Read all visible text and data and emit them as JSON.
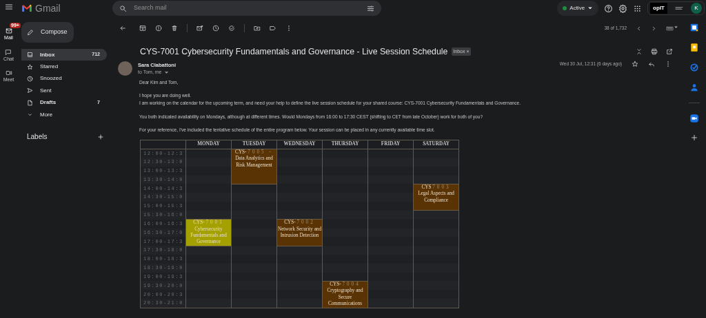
{
  "rail": [
    {
      "label": "Mail",
      "badge": "99+",
      "selected": true
    },
    {
      "label": "Chat",
      "selected": false
    },
    {
      "label": "Meet",
      "selected": false
    }
  ],
  "header": {
    "brand": "Gmail",
    "search_placeholder": "Search mail",
    "status": "Active",
    "org_logo": "opIT",
    "avatar_initial": "K"
  },
  "sidebar": {
    "compose": "Compose",
    "items": [
      {
        "label": "Inbox",
        "count": "712",
        "bold": true,
        "selected": true
      },
      {
        "label": "Starred",
        "bold": false,
        "selected": false
      },
      {
        "label": "Snoozed",
        "bold": false,
        "selected": false
      },
      {
        "label": "Sent",
        "bold": false,
        "selected": false
      },
      {
        "label": "Drafts",
        "count": "7",
        "bold": true,
        "selected": false
      },
      {
        "label": "More",
        "bold": false,
        "selected": false
      }
    ],
    "labels_heading": "Labels"
  },
  "toolbar": {
    "counter": "38 of 1,732"
  },
  "message": {
    "subject": "CYS-7001 Cybersecurity Fundamentals and Governance - Live Session Schedule",
    "tag": "Inbox",
    "tag_close": "×",
    "sender": "Sara Clabattoni",
    "recipients": "to Tom, me",
    "date": "Wed 30 Jul, 12:31 (6 days ago)",
    "paragraphs": [
      [
        "Dear Kim and Tom,"
      ],
      [
        "I hope you are doing well.",
        "I am working on the calendar for the upcoming term, and need your help to define the live session schedule for your shared course: CYS-7001 Cybersecurity Fundamentals and Governance."
      ],
      [
        "You both indicated availability on Mondays, although at different times. Would Mondays from 16:00 to 17:30 CEST (shifting to CET from late October) work for both of you?"
      ],
      [
        "For your reference, I've included the tentative schedule of the entire program below. Your session can be placed in any currently available time slot."
      ]
    ]
  },
  "schedule": {
    "times": [
      "12:00-12:3",
      "12:30-13:0",
      "13:00-13:3",
      "13:30-14:0",
      "14:00-14:3",
      "14:30-15:0",
      "15:00-15:3",
      "15:30-16:0",
      "16:00-16:3",
      "16:30-17:0",
      "17:00-17:3",
      "17:30-18:0",
      "18:00-18:3",
      "18:30-19:0",
      "19:00-19:3",
      "19:30-20:0",
      "20:00-20:3",
      "20:30-21:0"
    ],
    "days": [
      {
        "name": "MONDAY",
        "slots": [
          {
            "kind": "empty"
          },
          {
            "kind": "empty"
          },
          {
            "kind": "empty"
          },
          {
            "kind": "empty"
          },
          {
            "kind": "empty"
          },
          {
            "kind": "empty"
          },
          {
            "kind": "empty"
          },
          {
            "kind": "empty"
          },
          {
            "kind": "session",
            "code_prefix": "CYS-",
            "code_number": "7001",
            "title": "Cybersecurity Fundamentals and Governance",
            "color": "#a3a000"
          },
          {
            "kind": "continued"
          },
          {
            "kind": "continued"
          },
          {
            "kind": "empty"
          },
          {
            "kind": "empty"
          },
          {
            "kind": "empty"
          },
          {
            "kind": "empty"
          },
          {
            "kind": "empty"
          },
          {
            "kind": "empty"
          },
          {
            "kind": "empty"
          }
        ]
      },
      {
        "name": "TUESDAY",
        "slots": [
          {
            "kind": "session",
            "code_prefix": "CYS-",
            "code_number": "7005 -",
            "title": "Data Analytics and Risk Management",
            "color": "#5a3305"
          },
          {
            "kind": "continued"
          },
          {
            "kind": "continued"
          },
          {
            "kind": "continued"
          },
          {
            "kind": "empty"
          },
          {
            "kind": "empty"
          },
          {
            "kind": "empty"
          },
          {
            "kind": "empty"
          },
          {
            "kind": "empty"
          },
          {
            "kind": "empty"
          },
          {
            "kind": "empty"
          },
          {
            "kind": "empty"
          },
          {
            "kind": "empty"
          },
          {
            "kind": "empty"
          },
          {
            "kind": "empty"
          },
          {
            "kind": "empty"
          },
          {
            "kind": "empty"
          },
          {
            "kind": "empty"
          }
        ]
      },
      {
        "name": "WEDNESDAY",
        "slots": [
          {
            "kind": "empty"
          },
          {
            "kind": "empty"
          },
          {
            "kind": "empty"
          },
          {
            "kind": "empty"
          },
          {
            "kind": "empty"
          },
          {
            "kind": "empty"
          },
          {
            "kind": "empty"
          },
          {
            "kind": "empty"
          },
          {
            "kind": "session",
            "code_prefix": "CYS-",
            "code_number": "7002",
            "title": "Network Security and Intrusion Detection",
            "color": "#5a3305"
          },
          {
            "kind": "continued"
          },
          {
            "kind": "continued"
          },
          {
            "kind": "empty"
          },
          {
            "kind": "empty"
          },
          {
            "kind": "empty"
          },
          {
            "kind": "empty"
          },
          {
            "kind": "empty"
          },
          {
            "kind": "empty"
          },
          {
            "kind": "empty"
          }
        ]
      },
      {
        "name": "THURSDAY",
        "slots": [
          {
            "kind": "empty"
          },
          {
            "kind": "empty"
          },
          {
            "kind": "empty"
          },
          {
            "kind": "empty"
          },
          {
            "kind": "empty"
          },
          {
            "kind": "empty"
          },
          {
            "kind": "empty"
          },
          {
            "kind": "empty"
          },
          {
            "kind": "empty"
          },
          {
            "kind": "empty"
          },
          {
            "kind": "empty"
          },
          {
            "kind": "empty"
          },
          {
            "kind": "empty"
          },
          {
            "kind": "empty"
          },
          {
            "kind": "empty"
          },
          {
            "kind": "session",
            "code_prefix": "CYS-",
            "code_number": "7004",
            "title": "Cryptography and Secure Communications",
            "color": "#5a3305"
          },
          {
            "kind": "continued"
          },
          {
            "kind": "continued"
          }
        ]
      },
      {
        "name": "FRIDAY",
        "slots": [
          {
            "kind": "empty"
          },
          {
            "kind": "empty"
          },
          {
            "kind": "empty"
          },
          {
            "kind": "empty"
          },
          {
            "kind": "empty"
          },
          {
            "kind": "empty"
          },
          {
            "kind": "empty"
          },
          {
            "kind": "empty"
          },
          {
            "kind": "empty"
          },
          {
            "kind": "empty"
          },
          {
            "kind": "empty"
          },
          {
            "kind": "empty"
          },
          {
            "kind": "empty"
          },
          {
            "kind": "empty"
          },
          {
            "kind": "empty"
          },
          {
            "kind": "empty"
          },
          {
            "kind": "empty"
          },
          {
            "kind": "empty"
          }
        ]
      },
      {
        "name": "SATURDAY",
        "slots": [
          {
            "kind": "empty"
          },
          {
            "kind": "empty"
          },
          {
            "kind": "empty"
          },
          {
            "kind": "empty"
          },
          {
            "kind": "session",
            "code_prefix": "CYS",
            "code_number": "7003",
            "title": "Legal Aspects and Compliance",
            "color": "#5a3305"
          },
          {
            "kind": "continued"
          },
          {
            "kind": "continued"
          },
          {
            "kind": "empty"
          },
          {
            "kind": "empty"
          },
          {
            "kind": "empty"
          },
          {
            "kind": "empty"
          },
          {
            "kind": "empty"
          },
          {
            "kind": "empty"
          },
          {
            "kind": "empty"
          },
          {
            "kind": "empty"
          },
          {
            "kind": "empty"
          },
          {
            "kind": "empty"
          },
          {
            "kind": "empty"
          }
        ]
      }
    ]
  }
}
